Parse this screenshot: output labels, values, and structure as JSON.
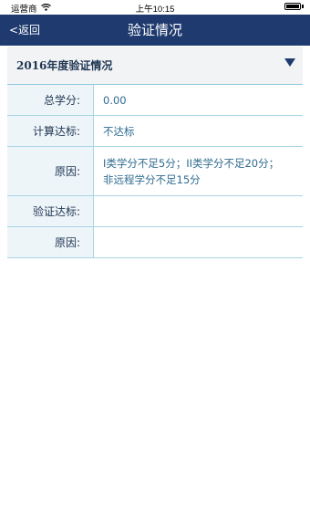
{
  "status_bar": {
    "carrier": "运营商",
    "time": "上午10:15",
    "wifi_icon": "wifi-icon",
    "battery_level": 1.0
  },
  "navbar": {
    "back_label": "<返回",
    "title": "验证情况"
  },
  "section": {
    "title": "2016年度验证情况",
    "collapse_icon": "triangle-down-icon"
  },
  "rows": [
    {
      "label": "总学分:",
      "value": "0.00"
    },
    {
      "label": "计算达标:",
      "value": "不达标"
    },
    {
      "label": "原因:",
      "value_line1": "I类学分不足5分；II类学分不足20分；",
      "value_line2": "非远程学分不足15分"
    },
    {
      "label": "验证达标:",
      "value": ""
    },
    {
      "label": "原因:",
      "value": ""
    }
  ],
  "colors": {
    "navbar_bg": "#1f3a6e",
    "label_bg": "#eef5f9",
    "border": "#a9d4e6",
    "value_text": "#2e6b8f"
  }
}
